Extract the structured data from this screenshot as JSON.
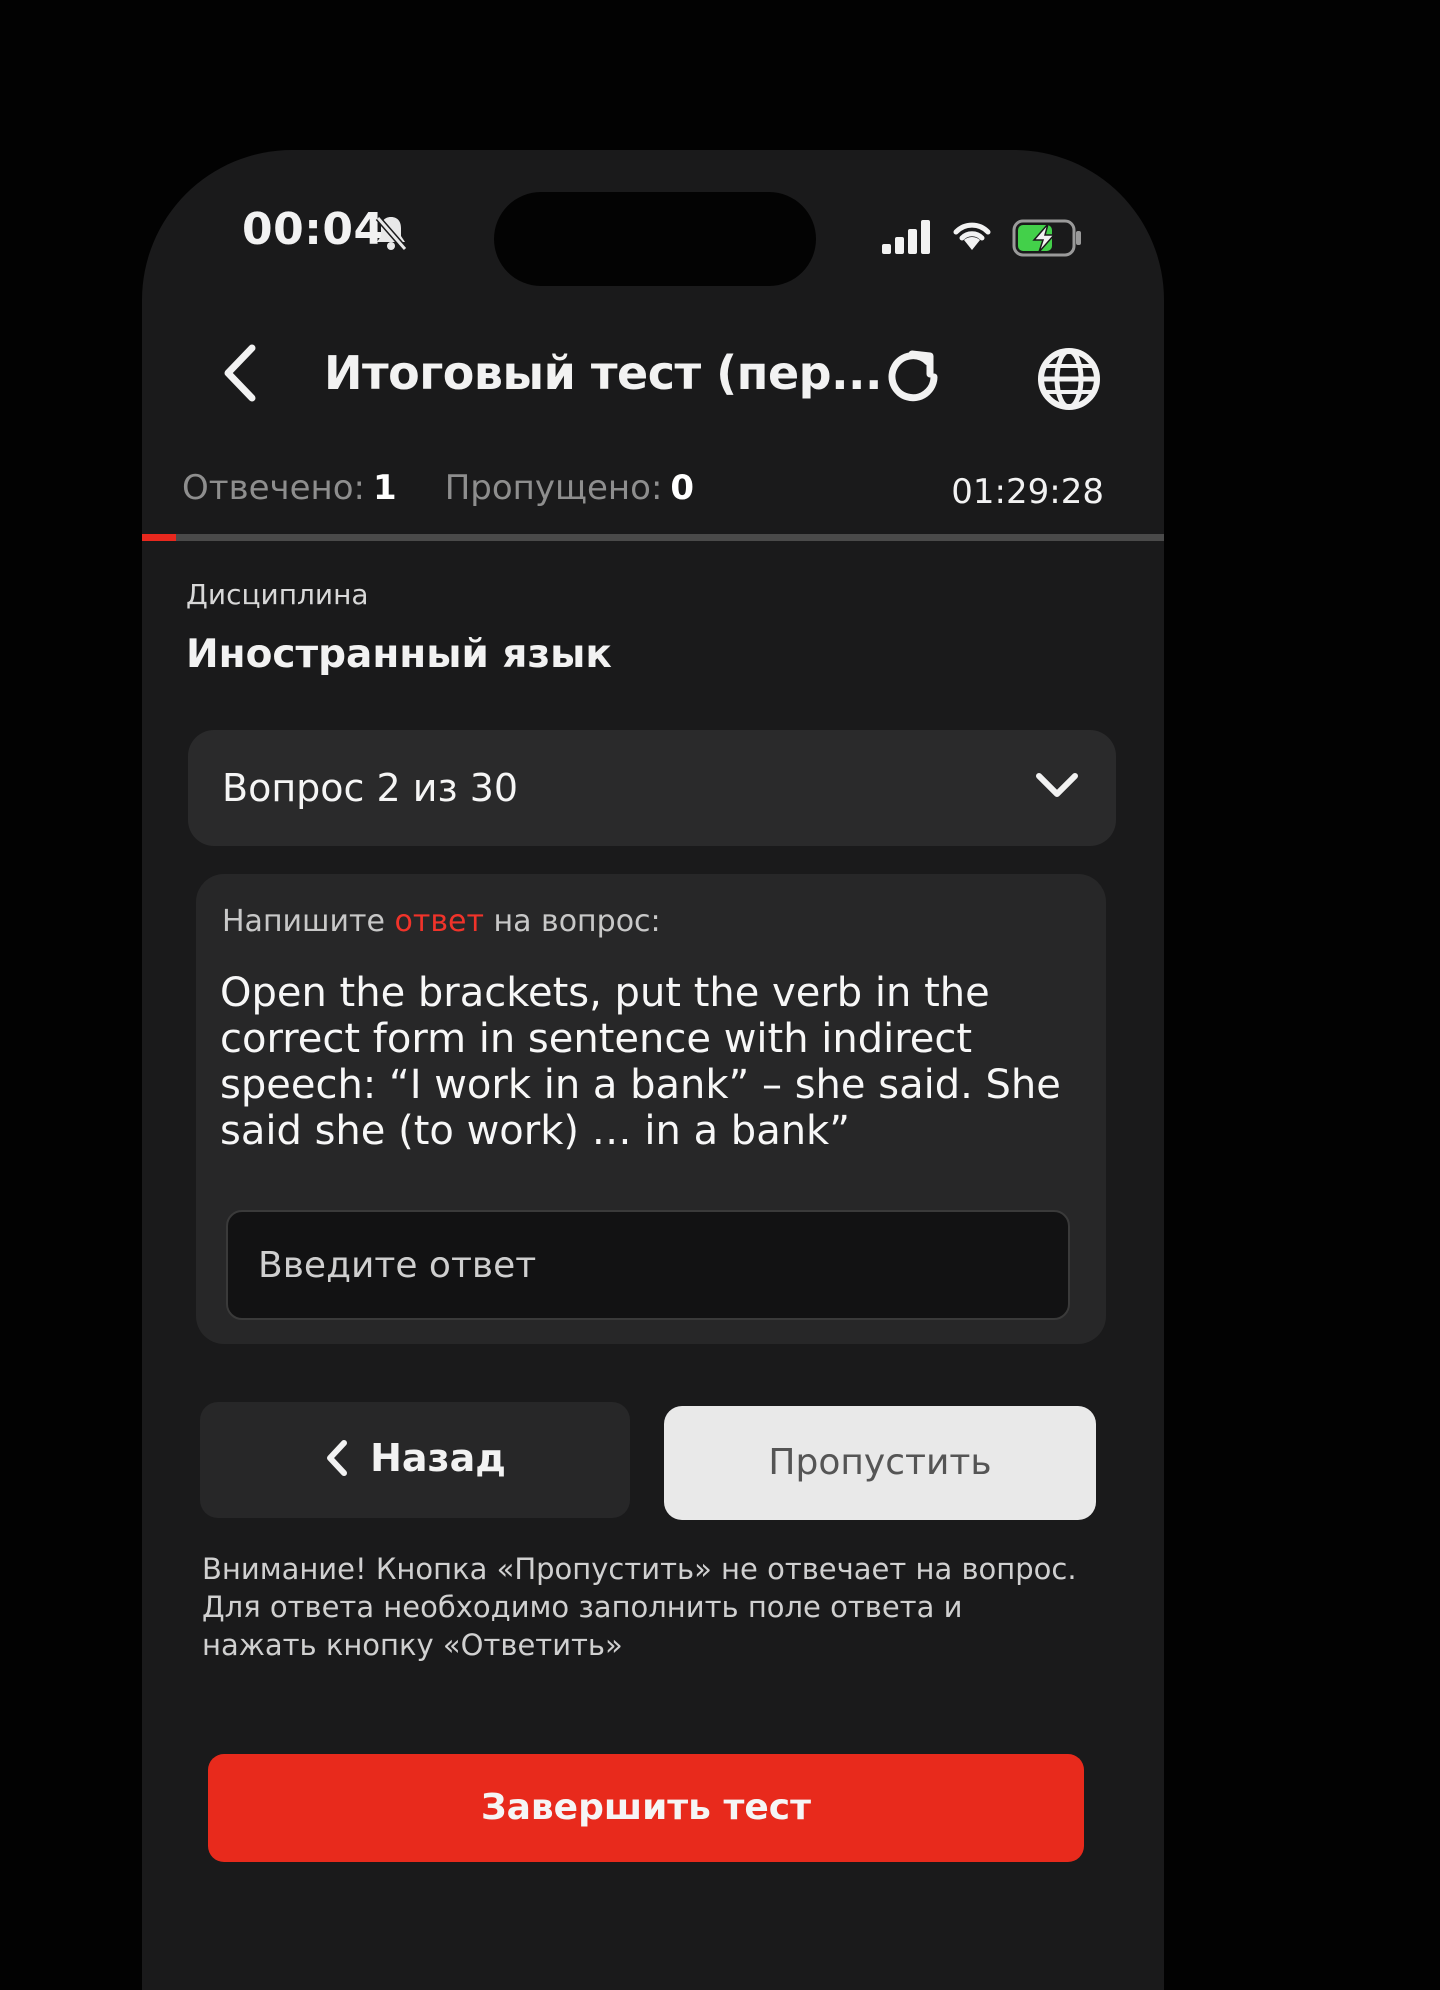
{
  "status_bar": {
    "time": "00:04",
    "icons": [
      "bell-slash-icon",
      "signal-icon",
      "wifi-icon",
      "battery-charging-icon"
    ],
    "battery_color": "#43d04a"
  },
  "header": {
    "title": "Итоговый тест (пер...",
    "icons": [
      "back-icon",
      "refresh-icon",
      "globe-icon"
    ]
  },
  "stats": {
    "answered_label": "Отвечено:",
    "answered_value": "1",
    "skipped_label": "Пропущено:",
    "skipped_value": "0",
    "timer": "01:29:28",
    "progress_fraction": 0.033
  },
  "discipline": {
    "label": "Дисциплина",
    "name": "Иностранный язык"
  },
  "question_select": {
    "label": "Вопрос 2 из 30"
  },
  "question": {
    "instruction_before": "Напишите ",
    "instruction_highlight": "ответ",
    "instruction_after": " на вопрос:",
    "text": "Open the brackets, put the verb in the correct form in sentence with indirect speech: “I work in a bank” – she said. She said she (to work) … in a bank”",
    "input_placeholder": "Введите ответ"
  },
  "buttons": {
    "back": "Назад",
    "skip": "Пропустить",
    "finish": "Завершить тест"
  },
  "notice": "Внимание! Кнопка «Пропустить» не отвечает на вопрос. Для ответа необходимо заполнить поле ответа и нажать кнопку «Ответить»",
  "colors": {
    "accent": "#e82a1c",
    "background": "#1a1a1b",
    "card": "#272728"
  }
}
